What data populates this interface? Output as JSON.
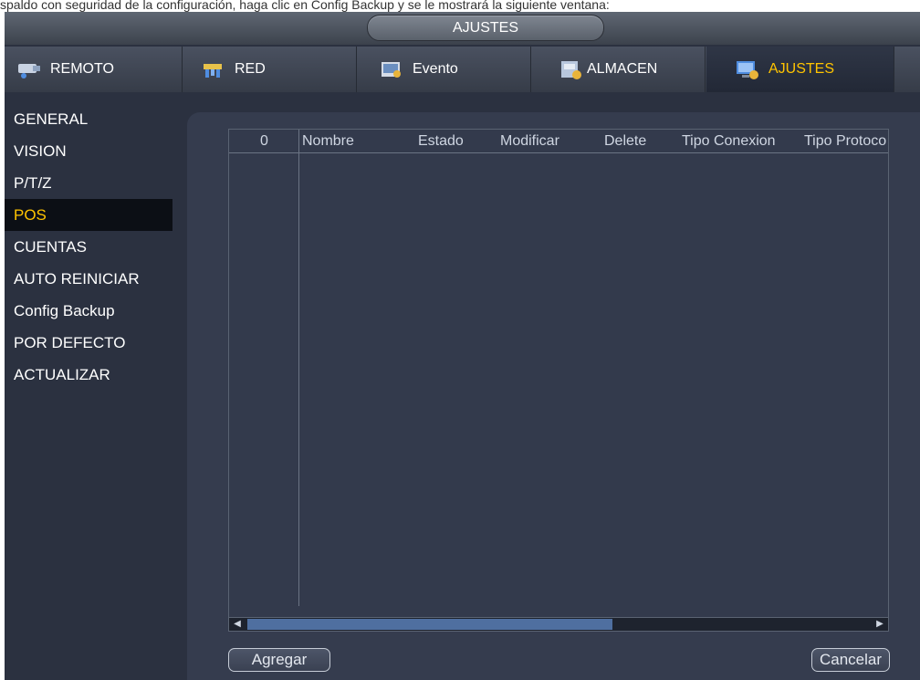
{
  "header": {
    "snippet_text": "spaldo con seguridad de la configuración, haga clic en Config Backup y se le mostrará la siguiente ventana:"
  },
  "window": {
    "title": "AJUSTES"
  },
  "tabs": [
    {
      "label": "REMOTO",
      "icon": "camera-network-icon"
    },
    {
      "label": "RED",
      "icon": "network-icon"
    },
    {
      "label": "Evento",
      "icon": "event-icon"
    },
    {
      "label": "ALMACEN",
      "icon": "storage-icon"
    },
    {
      "label": "AJUSTES",
      "icon": "settings-monitor-icon"
    }
  ],
  "sidebar": {
    "items": [
      {
        "label": "GENERAL"
      },
      {
        "label": "VISION"
      },
      {
        "label": "P/T/Z"
      },
      {
        "label": "POS"
      },
      {
        "label": "CUENTAS"
      },
      {
        "label": "AUTO REINICIAR"
      },
      {
        "label": "Config Backup"
      },
      {
        "label": "POR DEFECTO"
      },
      {
        "label": "ACTUALIZAR"
      }
    ],
    "active": "POS"
  },
  "table": {
    "columns": [
      "0",
      "Nombre",
      "Estado",
      "Modificar",
      "Delete",
      "Tipo Conexion",
      "Tipo Protoco"
    ],
    "rows": []
  },
  "buttons": {
    "add": "Agregar",
    "cancel": "Cancelar"
  },
  "colors": {
    "accent": "#ffc400",
    "background": "#2b3140"
  }
}
